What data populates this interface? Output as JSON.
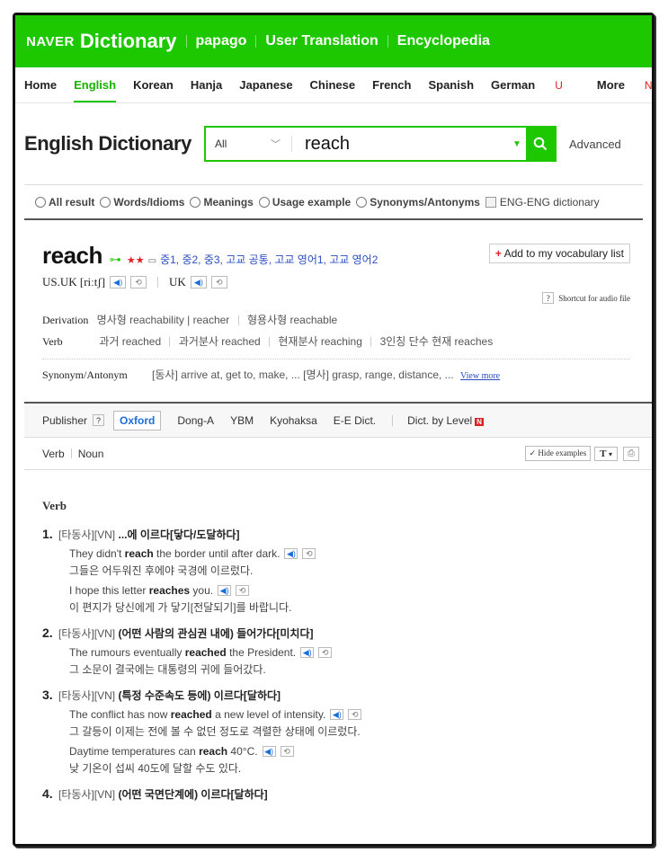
{
  "header": {
    "naver": "NAVER",
    "dictionary": "Dictionary",
    "links": [
      "papago",
      "User Translation",
      "Encyclopedia"
    ]
  },
  "langs": {
    "home": "Home",
    "english": "English",
    "korean": "Korean",
    "hanja": "Hanja",
    "japanese": "Japanese",
    "chinese": "Chinese",
    "french": "French",
    "spanish": "Spanish",
    "german": "German",
    "german_tag": "U",
    "more": "More",
    "more_tag": "N"
  },
  "search": {
    "title": "English Dictionary",
    "category": "All",
    "query": "reach",
    "advanced": "Advanced"
  },
  "filter": {
    "all": "All result",
    "words": "Words/Idioms",
    "meanings": "Meanings",
    "usage": "Usage example",
    "synonyms": "Synonyms/Antonyms",
    "engeng": "ENG-ENG dictionary"
  },
  "entry": {
    "word": "reach",
    "stars": "★★",
    "levels": "중1, 중2, 중3, 고교 공통, 고교 영어1, 고교 영어2",
    "add_vocab": "Add to my vocabulary list",
    "us_uk": "US.UK [riːtʃ]",
    "uk": "UK",
    "shortcut": "Shortcut for audio file",
    "derivation_label": "Derivation",
    "derivation_noun": "명사형 reachability | reacher",
    "derivation_adj": "형용사형 reachable",
    "verb_label": "Verb",
    "past": "과거 reached",
    "past_participle": "과거분사 reached",
    "present_participle": "현재분사 reaching",
    "third_person": "3인칭 단수 현재 reaches",
    "synonym_label": "Synonym/Antonym",
    "synonyms": "[동사] arrive at, get to, make, ... [명사] grasp, range, distance, ...",
    "view_more": "View more"
  },
  "publisher": {
    "label": "Publisher",
    "oxford": "Oxford",
    "items": [
      "Dong-A",
      "YBM",
      "Kyohaksa",
      "E-E Dict."
    ],
    "by_level": "Dict. by Level",
    "new_badge": "N"
  },
  "pos": {
    "verb": "Verb",
    "noun": "Noun",
    "hide_examples": "Hide examples",
    "t": "T"
  },
  "senses": {
    "heading": "Verb",
    "s1": {
      "num": "1.",
      "gram": "[타동사][VN]",
      "meaning": "...에 이르다[닿다/도달하다]",
      "ex1_pre": "They didn't ",
      "ex1_b": "reach",
      "ex1_post": " the border until after dark.",
      "ex1_ko": "그들은 어두워진 후에야 국경에 이르렀다.",
      "ex2_pre": "I hope this letter ",
      "ex2_b": "reaches",
      "ex2_post": " you.",
      "ex2_ko": "이 편지가 당신에게 가 닿기[전달되기]를 바랍니다."
    },
    "s2": {
      "num": "2.",
      "gram": "[타동사][VN]",
      "meaning": "(어떤 사람의 관심권 내에) 들어가다[미치다]",
      "ex1_pre": "The rumours eventually ",
      "ex1_b": "reached",
      "ex1_post": " the President.",
      "ex1_ko": "그 소문이 결국에는 대통령의 귀에 들어갔다."
    },
    "s3": {
      "num": "3.",
      "gram": "[타동사][VN]",
      "meaning": "(특정 수준속도 등에) 이르다[달하다]",
      "ex1_pre": "The conflict has now ",
      "ex1_b": "reached",
      "ex1_post": " a new level of intensity.",
      "ex1_ko": "그 갈등이 이제는 전에 볼 수 없던 정도로 격렬한 상태에 이르렀다.",
      "ex2_pre": "Daytime temperatures can ",
      "ex2_b": "reach",
      "ex2_post": " 40°C.",
      "ex2_ko": "낮 기온이 섭씨 40도에 달할 수도 있다."
    },
    "s4": {
      "num": "4.",
      "gram": "[타동사][VN]",
      "meaning": "(어떤 국면단계에) 이르다[달하다]"
    }
  },
  "colors": {
    "brand": "#1ec800",
    "link": "#2b4dc2",
    "accent_red": "#e02020"
  }
}
